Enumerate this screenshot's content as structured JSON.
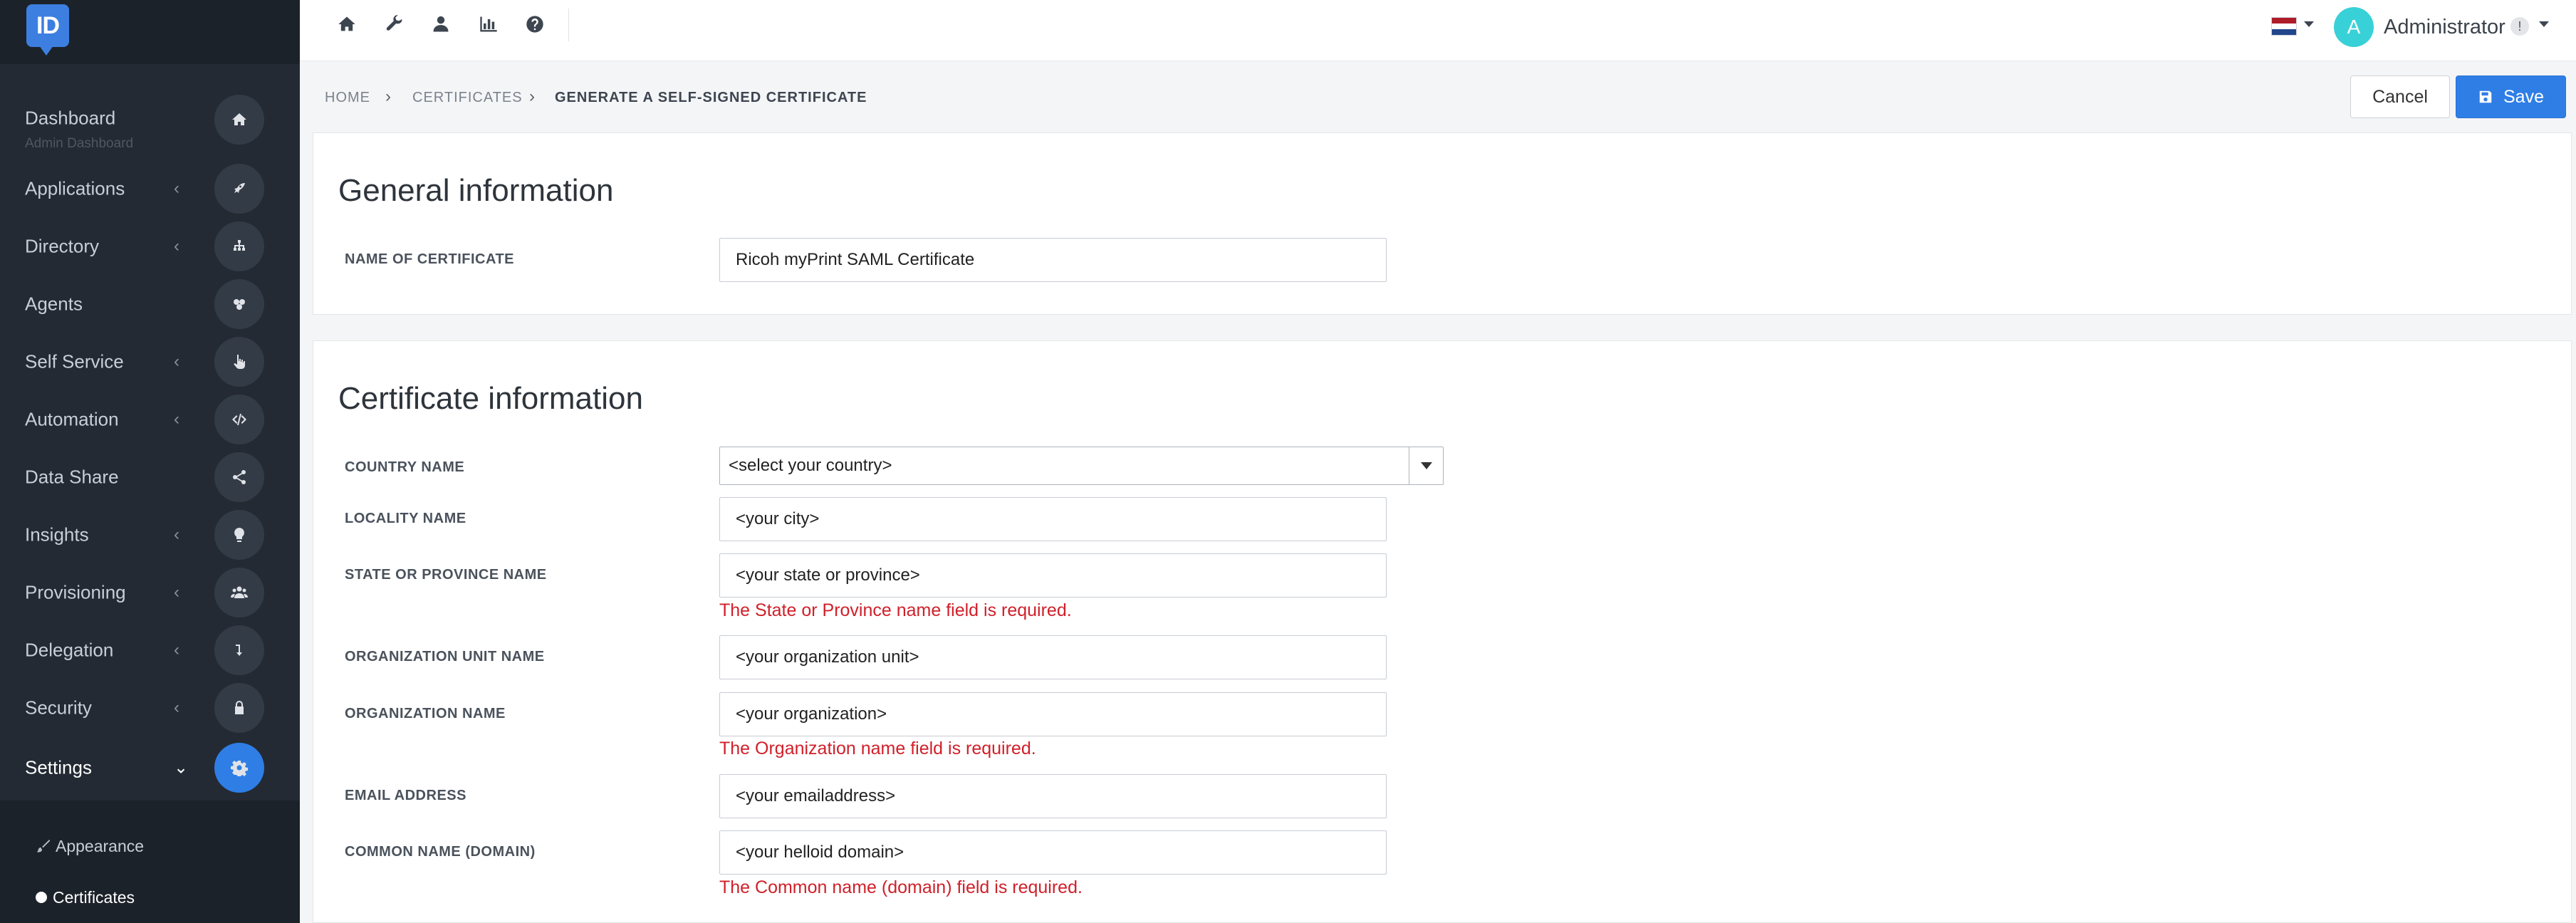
{
  "app": {
    "logo_text": "ID",
    "accent": "#2f7ee6",
    "sidebar_bg": "#232a33",
    "error_color": "#d0202a"
  },
  "sidebar": {
    "dashboard_sub": "Admin Dashboard",
    "items": [
      {
        "label": "Dashboard",
        "icon": "home-icon"
      },
      {
        "label": "Applications",
        "icon": "rocket-icon"
      },
      {
        "label": "Directory",
        "icon": "sitemap-icon"
      },
      {
        "label": "Agents",
        "icon": "agents-icon"
      },
      {
        "label": "Self Service",
        "icon": "hand-pointer-icon"
      },
      {
        "label": "Automation",
        "icon": "code-icon"
      },
      {
        "label": "Data Share",
        "icon": "share-icon"
      },
      {
        "label": "Insights",
        "icon": "lightbulb-icon"
      },
      {
        "label": "Provisioning",
        "icon": "users-icon"
      },
      {
        "label": "Delegation",
        "icon": "level-down-icon"
      },
      {
        "label": "Security",
        "icon": "lock-icon"
      },
      {
        "label": "Settings",
        "icon": "gear-icon"
      }
    ],
    "subitems": [
      {
        "label": "Appearance",
        "icon": "paint-brush-icon"
      },
      {
        "label": "Certificates",
        "icon": "dot-icon"
      }
    ]
  },
  "topbar": {
    "icons": [
      "home-icon",
      "wrench-icon",
      "user-icon",
      "bar-chart-icon",
      "question-circle-icon"
    ],
    "avatar_letter": "A",
    "username": "Administrator",
    "badge": "!"
  },
  "breadcrumb": {
    "home": "Home",
    "certificates": "Certificates",
    "current": "Generate a self-signed certificate"
  },
  "actions": {
    "cancel": "Cancel",
    "save": "Save"
  },
  "general": {
    "title": "General information",
    "name_label": "Name of certificate",
    "name_value": "Ricoh myPrint SAML Certificate"
  },
  "certificate": {
    "title": "Certificate information",
    "country_label": "Country name",
    "country_value": "<select your country>",
    "locality_label": "Locality name",
    "locality_placeholder": "<your city>",
    "state_label": "State or province name",
    "state_placeholder": "<your state or province>",
    "state_error": "The State or Province name field is required.",
    "org_unit_label": "Organization unit name",
    "org_unit_placeholder": "<your organization unit>",
    "org_label": "Organization name",
    "org_placeholder": "<your organization>",
    "org_error": "The Organization name field is required.",
    "email_label": "Email address",
    "email_placeholder": "<your emailaddress>",
    "common_label": "Common name (domain)",
    "common_placeholder": "<your helloid domain>",
    "common_error": "The Common name (domain) field is required."
  }
}
